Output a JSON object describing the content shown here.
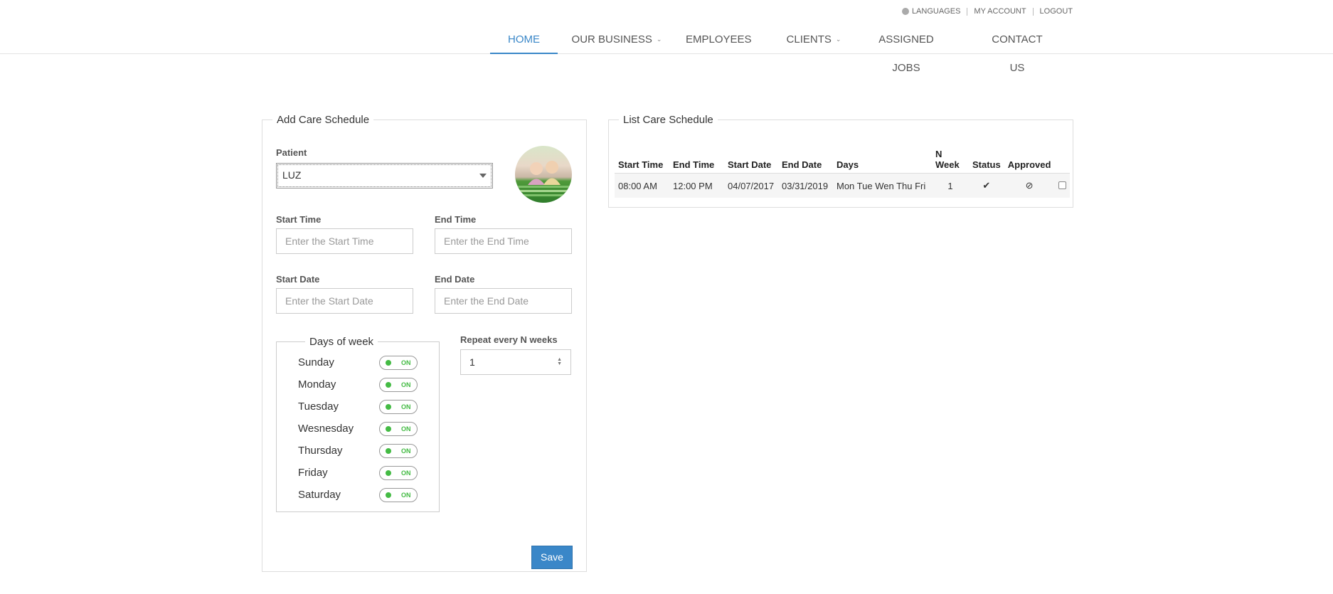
{
  "topbar": {
    "languages": "LANGUAGES",
    "account": "MY ACCOUNT",
    "logout": "LOGOUT"
  },
  "nav": {
    "items": [
      {
        "label": "HOME",
        "active": true
      },
      {
        "label": "OUR BUSINESS",
        "has_dropdown": true
      },
      {
        "label": "EMPLOYEES"
      },
      {
        "label": "CLIENTS",
        "has_dropdown": true
      },
      {
        "label": "ASSIGNED JOBS"
      },
      {
        "label": "CONTACT US"
      }
    ],
    "active_color": "#3a87c8"
  },
  "add_schedule": {
    "legend": "Add Care Schedule",
    "patient_label": "Patient",
    "patient_value": "LUZ",
    "start_time_label": "Start Time",
    "start_time_placeholder": "Enter the Start Time",
    "end_time_label": "End Time",
    "end_time_placeholder": "Enter the End Time",
    "start_date_label": "Start Date",
    "start_date_placeholder": "Enter the Start Date",
    "end_date_label": "End Date",
    "end_date_placeholder": "Enter the End Date",
    "days_title": "Days of week",
    "days": [
      {
        "name": "Sunday",
        "state": "ON"
      },
      {
        "name": "Monday",
        "state": "ON"
      },
      {
        "name": "Tuesday",
        "state": "ON"
      },
      {
        "name": "Wesnesday",
        "state": "ON"
      },
      {
        "name": "Thursday",
        "state": "ON"
      },
      {
        "name": "Friday",
        "state": "ON"
      },
      {
        "name": "Saturday",
        "state": "ON"
      }
    ],
    "repeat_label": "Repeat every N weeks",
    "repeat_value": "1",
    "save_label": "Save",
    "save_color": "#3a87c8"
  },
  "list_schedule": {
    "legend": "List Care Schedule",
    "headers": {
      "start_time": "Start Time",
      "end_time": "End Time",
      "start_date": "Start Date",
      "end_date": "End Date",
      "days": "Days",
      "n_week_1": "N",
      "n_week_2": "Week",
      "status": "Status",
      "approved": "Approved"
    },
    "rows": [
      {
        "start_time": "08:00 AM",
        "end_time": "12:00 PM",
        "start_date": "04/07/2017",
        "end_date": "03/31/2019",
        "days": "Mon Tue Wen Thu Fri",
        "n_week": "1",
        "status_icon": "check-icon",
        "approved_icon": "not-allowed-icon"
      }
    ]
  }
}
